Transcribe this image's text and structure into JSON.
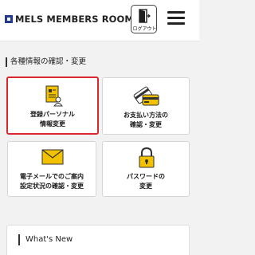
{
  "header": {
    "logo_text": "MELS MEMBERS ROOM",
    "logout_label": "ログアウト",
    "menu_icon": "hamburger-icon"
  },
  "section": {
    "title": "各種情報の確認・変更"
  },
  "cards": [
    {
      "line1": "登録パーソナル",
      "line2": "情報変更",
      "icon": "document-person-icon",
      "selected": true
    },
    {
      "line1": "お支払い方法の",
      "line2": "確認・変更",
      "icon": "credit-card-icon",
      "selected": false
    },
    {
      "line1": "電子メールでのご案内",
      "line2": "設定状況の確認・変更",
      "icon": "envelope-icon",
      "selected": false
    },
    {
      "line1": "パスワードの",
      "line2": "変更",
      "icon": "lock-icon",
      "selected": false
    }
  ],
  "whats_new": {
    "title": "What's New"
  },
  "colors": {
    "icon_yellow": "#f2c200",
    "selected_border": "#d9292e",
    "logo_blue": "#233a8a"
  }
}
